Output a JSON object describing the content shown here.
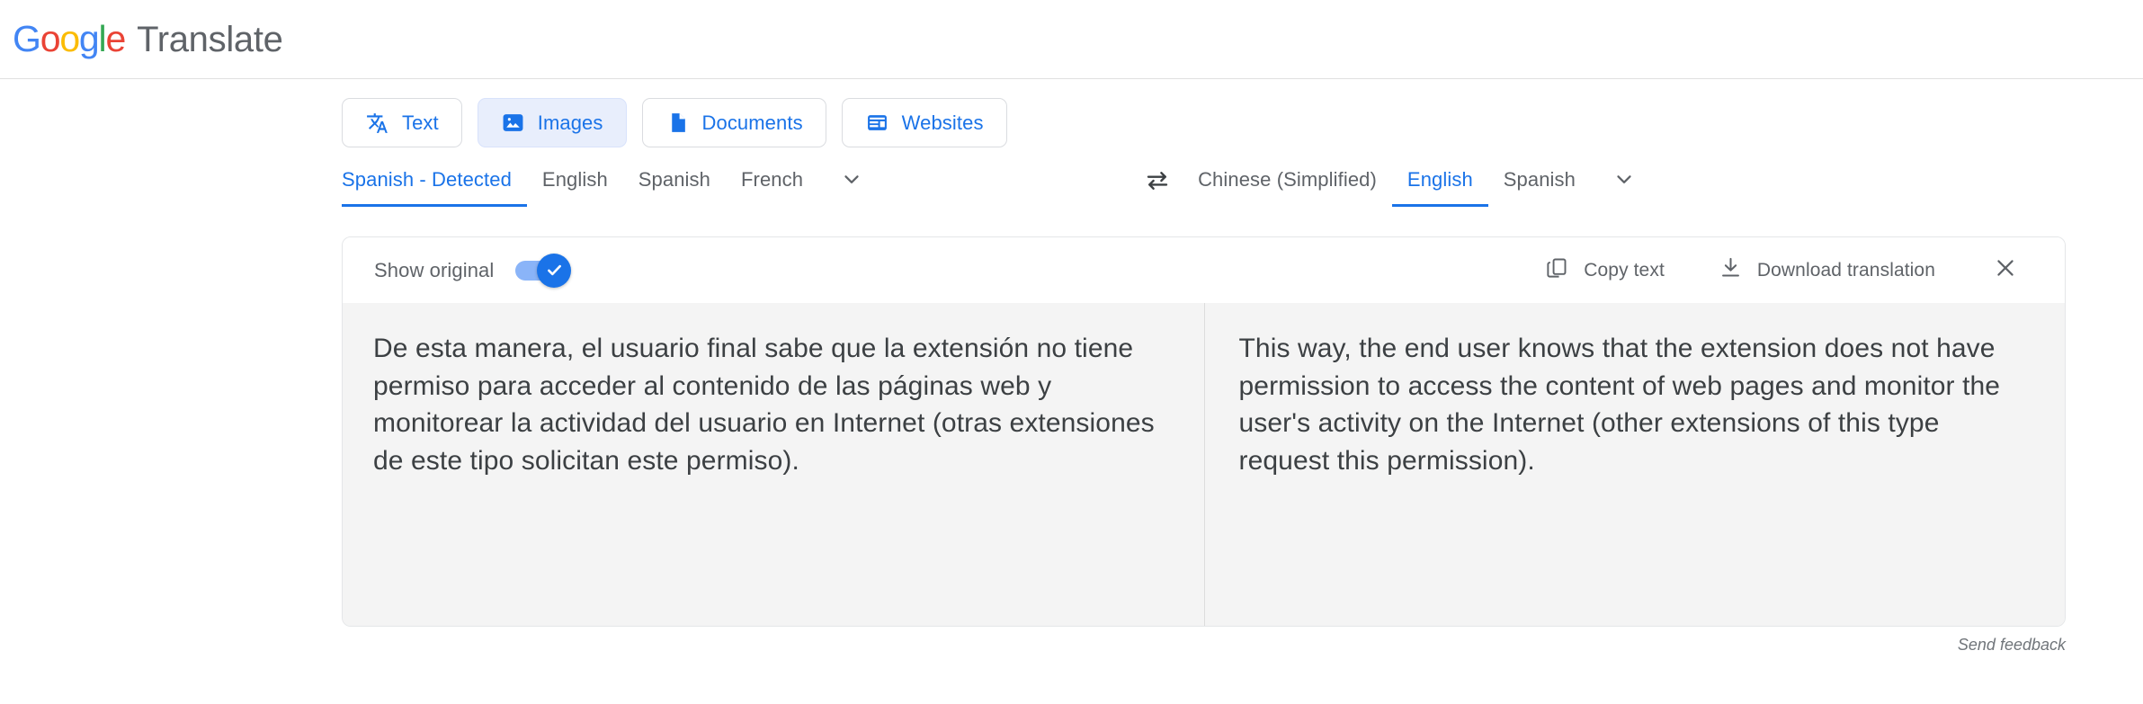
{
  "header": {
    "logo_parts": [
      {
        "ch": "G",
        "color_class": "b"
      },
      {
        "ch": "o",
        "color_class": "r"
      },
      {
        "ch": "o",
        "color_class": "y"
      },
      {
        "ch": "g",
        "color_class": "b"
      },
      {
        "ch": "l",
        "color_class": "g"
      },
      {
        "ch": "e",
        "color_class": "r"
      }
    ],
    "product": "Translate",
    "colors": {
      "blue": "#4285F4",
      "red": "#EA4335",
      "yellow": "#FBBC05",
      "green": "#34A853",
      "accent": "#1a73e8"
    }
  },
  "mode_tabs": [
    {
      "label": "Text",
      "icon": "translate-text-icon",
      "selected": false
    },
    {
      "label": "Images",
      "icon": "image-icon",
      "selected": true
    },
    {
      "label": "Documents",
      "icon": "document-icon",
      "selected": false
    },
    {
      "label": "Websites",
      "icon": "website-icon",
      "selected": false
    }
  ],
  "source_languages": {
    "items": [
      {
        "label": "Spanish - Detected",
        "active": true
      },
      {
        "label": "English",
        "active": false
      },
      {
        "label": "Spanish",
        "active": false
      },
      {
        "label": "French",
        "active": false
      }
    ],
    "more_icon": "chevron-down-icon"
  },
  "swap": {
    "icon": "swap-horizontal-icon"
  },
  "target_languages": {
    "items": [
      {
        "label": "Chinese (Simplified)",
        "active": false
      },
      {
        "label": "English",
        "active": true
      },
      {
        "label": "Spanish",
        "active": false
      }
    ],
    "more_icon": "chevron-down-icon"
  },
  "toolbar": {
    "show_original_label": "Show original",
    "show_original_on": true,
    "copy_label": "Copy text",
    "copy_icon": "copy-icon",
    "download_label": "Download translation",
    "download_icon": "download-icon",
    "close_icon": "close-icon"
  },
  "panes": {
    "source_text": "De esta manera, el usuario final sabe que la extensión no tiene permiso para acceder al contenido de las páginas web y monitorear la actividad del usuario en Internet (otras extensiones de este tipo solicitan este permiso).",
    "translated_text": "This way, the end user knows that the extension does not have permission to access the content of web pages and monitor the user's activity on the Internet (other extensions of this type request this permission)."
  },
  "footer": {
    "feedback_label": "Send feedback"
  }
}
